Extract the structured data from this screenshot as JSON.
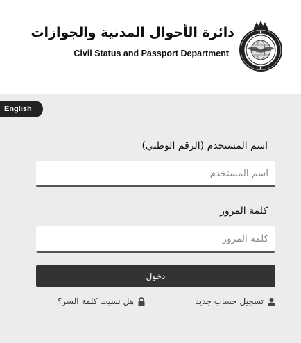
{
  "header": {
    "title_ar": "دائرة الأحوال المدنية والجوازات",
    "title_en": "Civil Status and Passport Department",
    "emblem_icon": "emblem-seal"
  },
  "language_toggle": {
    "label": "English"
  },
  "login_form": {
    "username_label": "اسم المستخدم (الرقم الوطني)",
    "username_placeholder": "اسم المستخدم",
    "password_label": "كلمة المرور",
    "password_placeholder": "كلمة المرور",
    "submit_label": "دخول"
  },
  "links": {
    "register": {
      "label": "تسجيل حساب جديد",
      "icon": "user-icon"
    },
    "forgot": {
      "label": "هل نسيت كلمة السر؟",
      "icon": "lock-icon"
    }
  },
  "colors": {
    "header_bg": "#ffffff",
    "page_bg": "#ececec",
    "button_bg": "#333333",
    "pill_bg": "#222222"
  }
}
